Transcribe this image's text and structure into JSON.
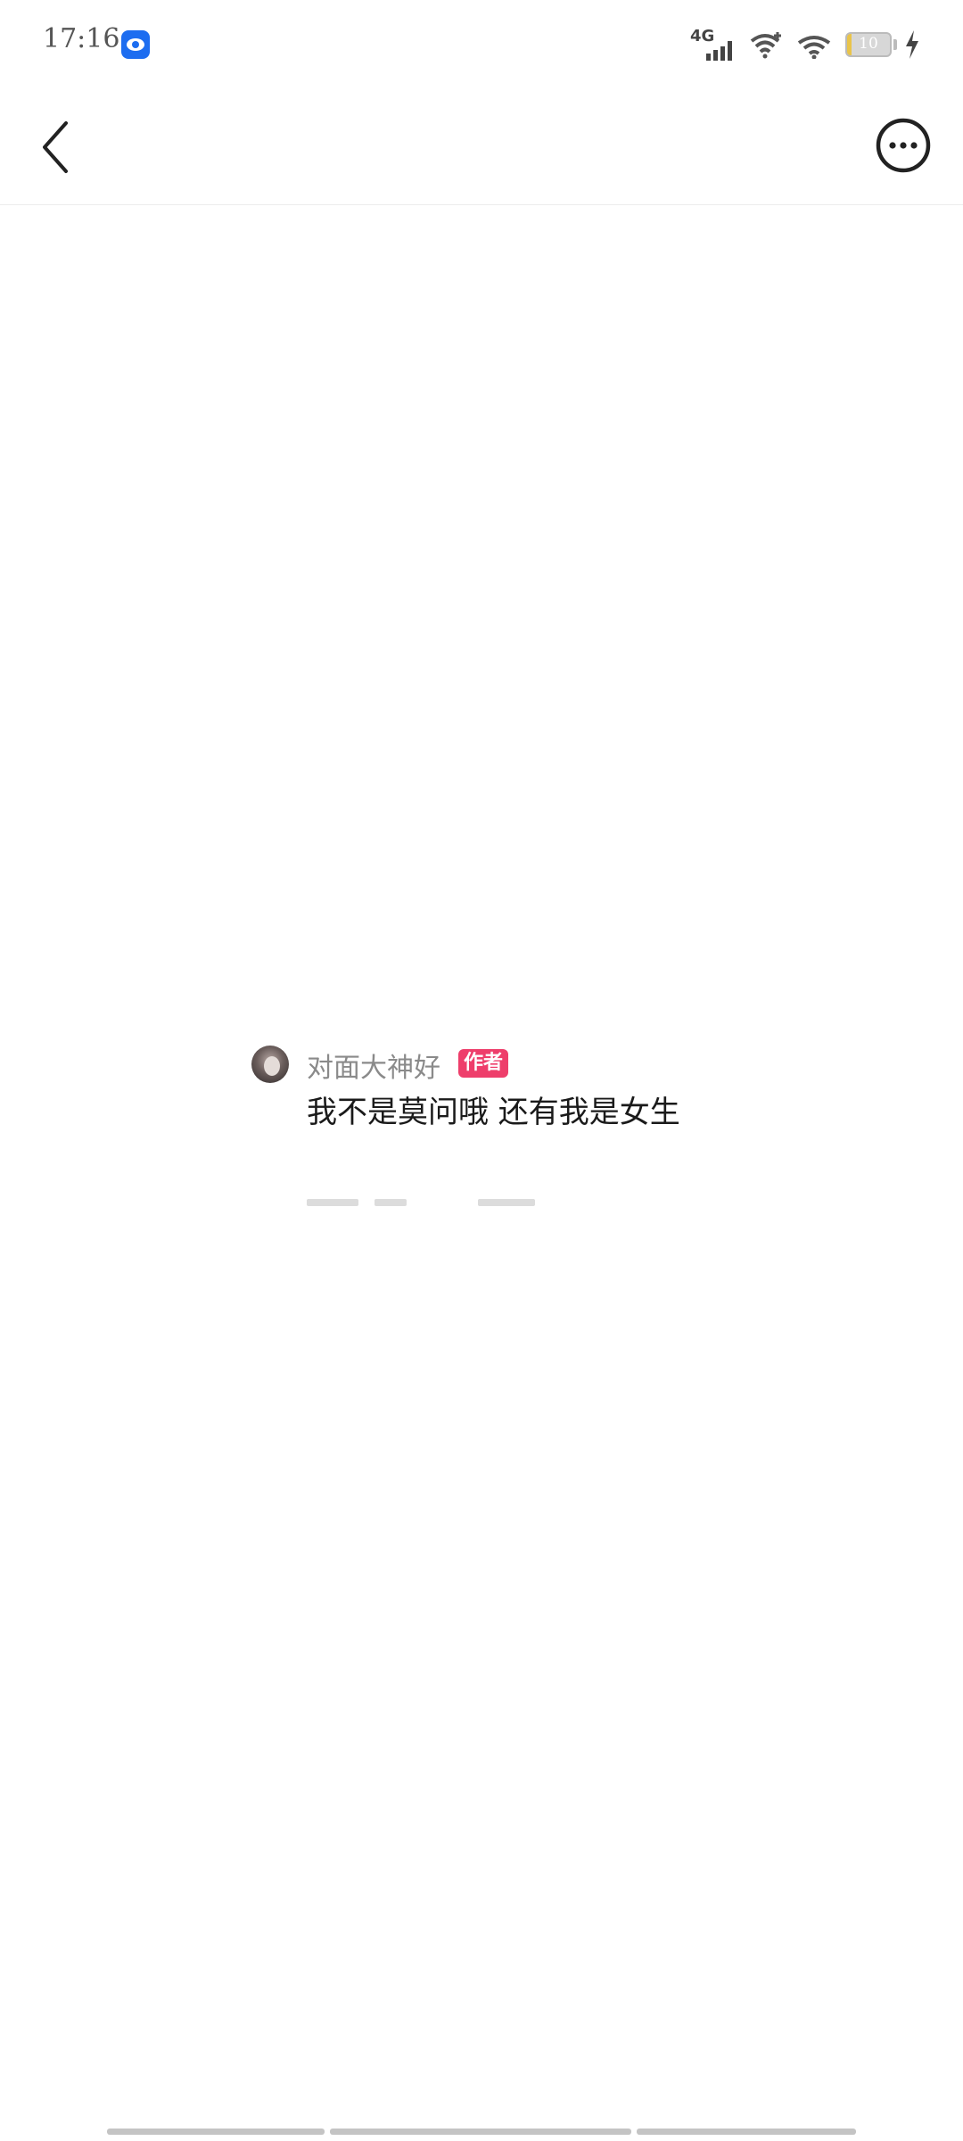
{
  "status_bar": {
    "time": "17:16",
    "network": "4G",
    "battery_level": "10",
    "battery_fraction": 0.1,
    "icons": [
      "app-icon",
      "signal-icon",
      "wifi-plus-icon",
      "wifi-icon",
      "battery-icon",
      "charging-bolt-icon"
    ]
  },
  "nav": {
    "back_icon": "chevron-left-icon",
    "more_icon": "more-options-icon"
  },
  "comment": {
    "username": "对面大神好",
    "badge": "作者",
    "text": "我不是莫问哦 还有我是女生"
  },
  "colors": {
    "badge": "#ee3e6b",
    "app_icon": "#1d6df0",
    "battery_fill": "#e9c44a"
  }
}
